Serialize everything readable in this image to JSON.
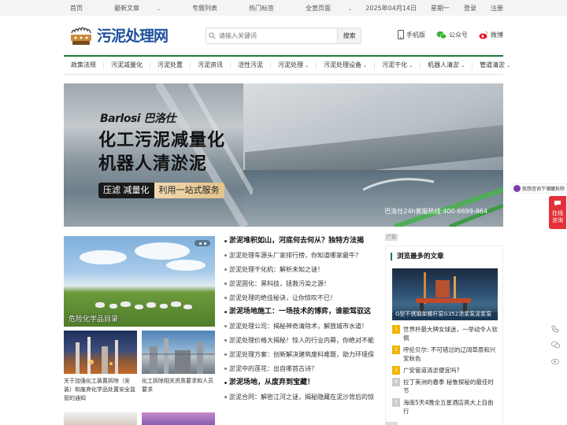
{
  "topbar": {
    "left": [
      {
        "label": "首页",
        "caret": false
      },
      {
        "label": "最新文章",
        "caret": true
      },
      {
        "label": "专题列表",
        "caret": false
      },
      {
        "label": "热门标签",
        "caret": false
      },
      {
        "label": "全宽页面",
        "caret": true
      }
    ],
    "date": "2025年04月14日",
    "weekday": "星期一",
    "login": "登录",
    "register": "注册"
  },
  "header": {
    "logo_text": "污泥处理网",
    "search_placeholder": "请输入关键词",
    "search_button": "搜索",
    "mobile": "手机版",
    "wechat_official": "公众号",
    "weibo": "微博"
  },
  "nav": [
    {
      "label": "政策法规",
      "caret": false
    },
    {
      "label": "污泥减量化",
      "caret": false
    },
    {
      "label": "污泥处置",
      "caret": false
    },
    {
      "label": "污泥资讯",
      "caret": false
    },
    {
      "label": "活性污泥",
      "caret": false
    },
    {
      "label": "污泥处理",
      "caret": true
    },
    {
      "label": "污泥处理设备",
      "caret": true
    },
    {
      "label": "污泥干化",
      "caret": true
    },
    {
      "label": "机器人清淤",
      "caret": true
    },
    {
      "label": "管道清淤",
      "caret": true
    }
  ],
  "banner": {
    "brand": "Barlosi 巴洛仕",
    "headline_1": "化工污泥减量化",
    "headline_2": "机器人清淤泥",
    "tag_a": "压滤 减量化",
    "tag_b": "利用一站式服务",
    "hotline": "巴洛仕24h客服热线:400-6699-864"
  },
  "float": {
    "consult": "我想咨询下储罐拆除",
    "online": "在线咨询"
  },
  "feature": {
    "caption": "危险化学品目录"
  },
  "thumbs": [
    {
      "title": "关于加强化工装置拆除（安装）和废弃化学品处置安全监管的通知"
    },
    {
      "title": "化工拆除相关资质要求和人员要求"
    }
  ],
  "articles": [
    {
      "type": "head",
      "text": "淤泥堆积如山，河底何去何从？独特方法揭"
    },
    {
      "type": "item",
      "text": "淤泥处理车源头厂家排行榜，你知道哪家最牛？"
    },
    {
      "type": "item",
      "text": "淤泥处理干化机：解析未知之谜！"
    },
    {
      "type": "item",
      "text": "淤泥固化：黑科技，拯救污染之源！"
    },
    {
      "type": "item",
      "text": "淤泥处理的绝佳秘诀，让你惊叹不已！"
    },
    {
      "type": "head",
      "text": "淤泥场地施工：一场技术的博弈，谁能驾驭这"
    },
    {
      "type": "item",
      "text": "淤泥处理公司：揭秘神奇清除术，解放城市水道！"
    },
    {
      "type": "item",
      "text": "淤泥处理价格大揭秘！惊人的行业内幕，你绝对不能"
    },
    {
      "type": "item",
      "text": "淤泥处理方案：创新解决建筑废料难题，助力环境保"
    },
    {
      "type": "item",
      "text": "淤泥中的莲花：出自哪首古诗？"
    },
    {
      "type": "head",
      "text": "淤泥场地，从废弃到宝藏！"
    },
    {
      "type": "item",
      "text": "淤泥合同：解密江河之谜，揭秘隐藏在泥沙背后的惊"
    }
  ],
  "right_widget": {
    "ad_label": "广告",
    "title": "浏览最多的文章",
    "pic_caption": "G型不锈钢单螺杆泵G352浓浆泵泥浆泵",
    "list": [
      {
        "rank": "1",
        "text": "世界杯最大牌女球迷，一举动令人钦佩"
      },
      {
        "rank": "2",
        "text": "呼伦贝尔: 不可错过的辽阔草原和兴安秋色"
      },
      {
        "rank": "3",
        "text": "广安管道清淤便宜吗?"
      },
      {
        "rank": "4",
        "text": "拉丁美洲的春季 秘鲁探秘的最佳时节"
      },
      {
        "rank": "5",
        "text": "海南5天4晚全五星酒店高大上自由行"
      }
    ]
  }
}
